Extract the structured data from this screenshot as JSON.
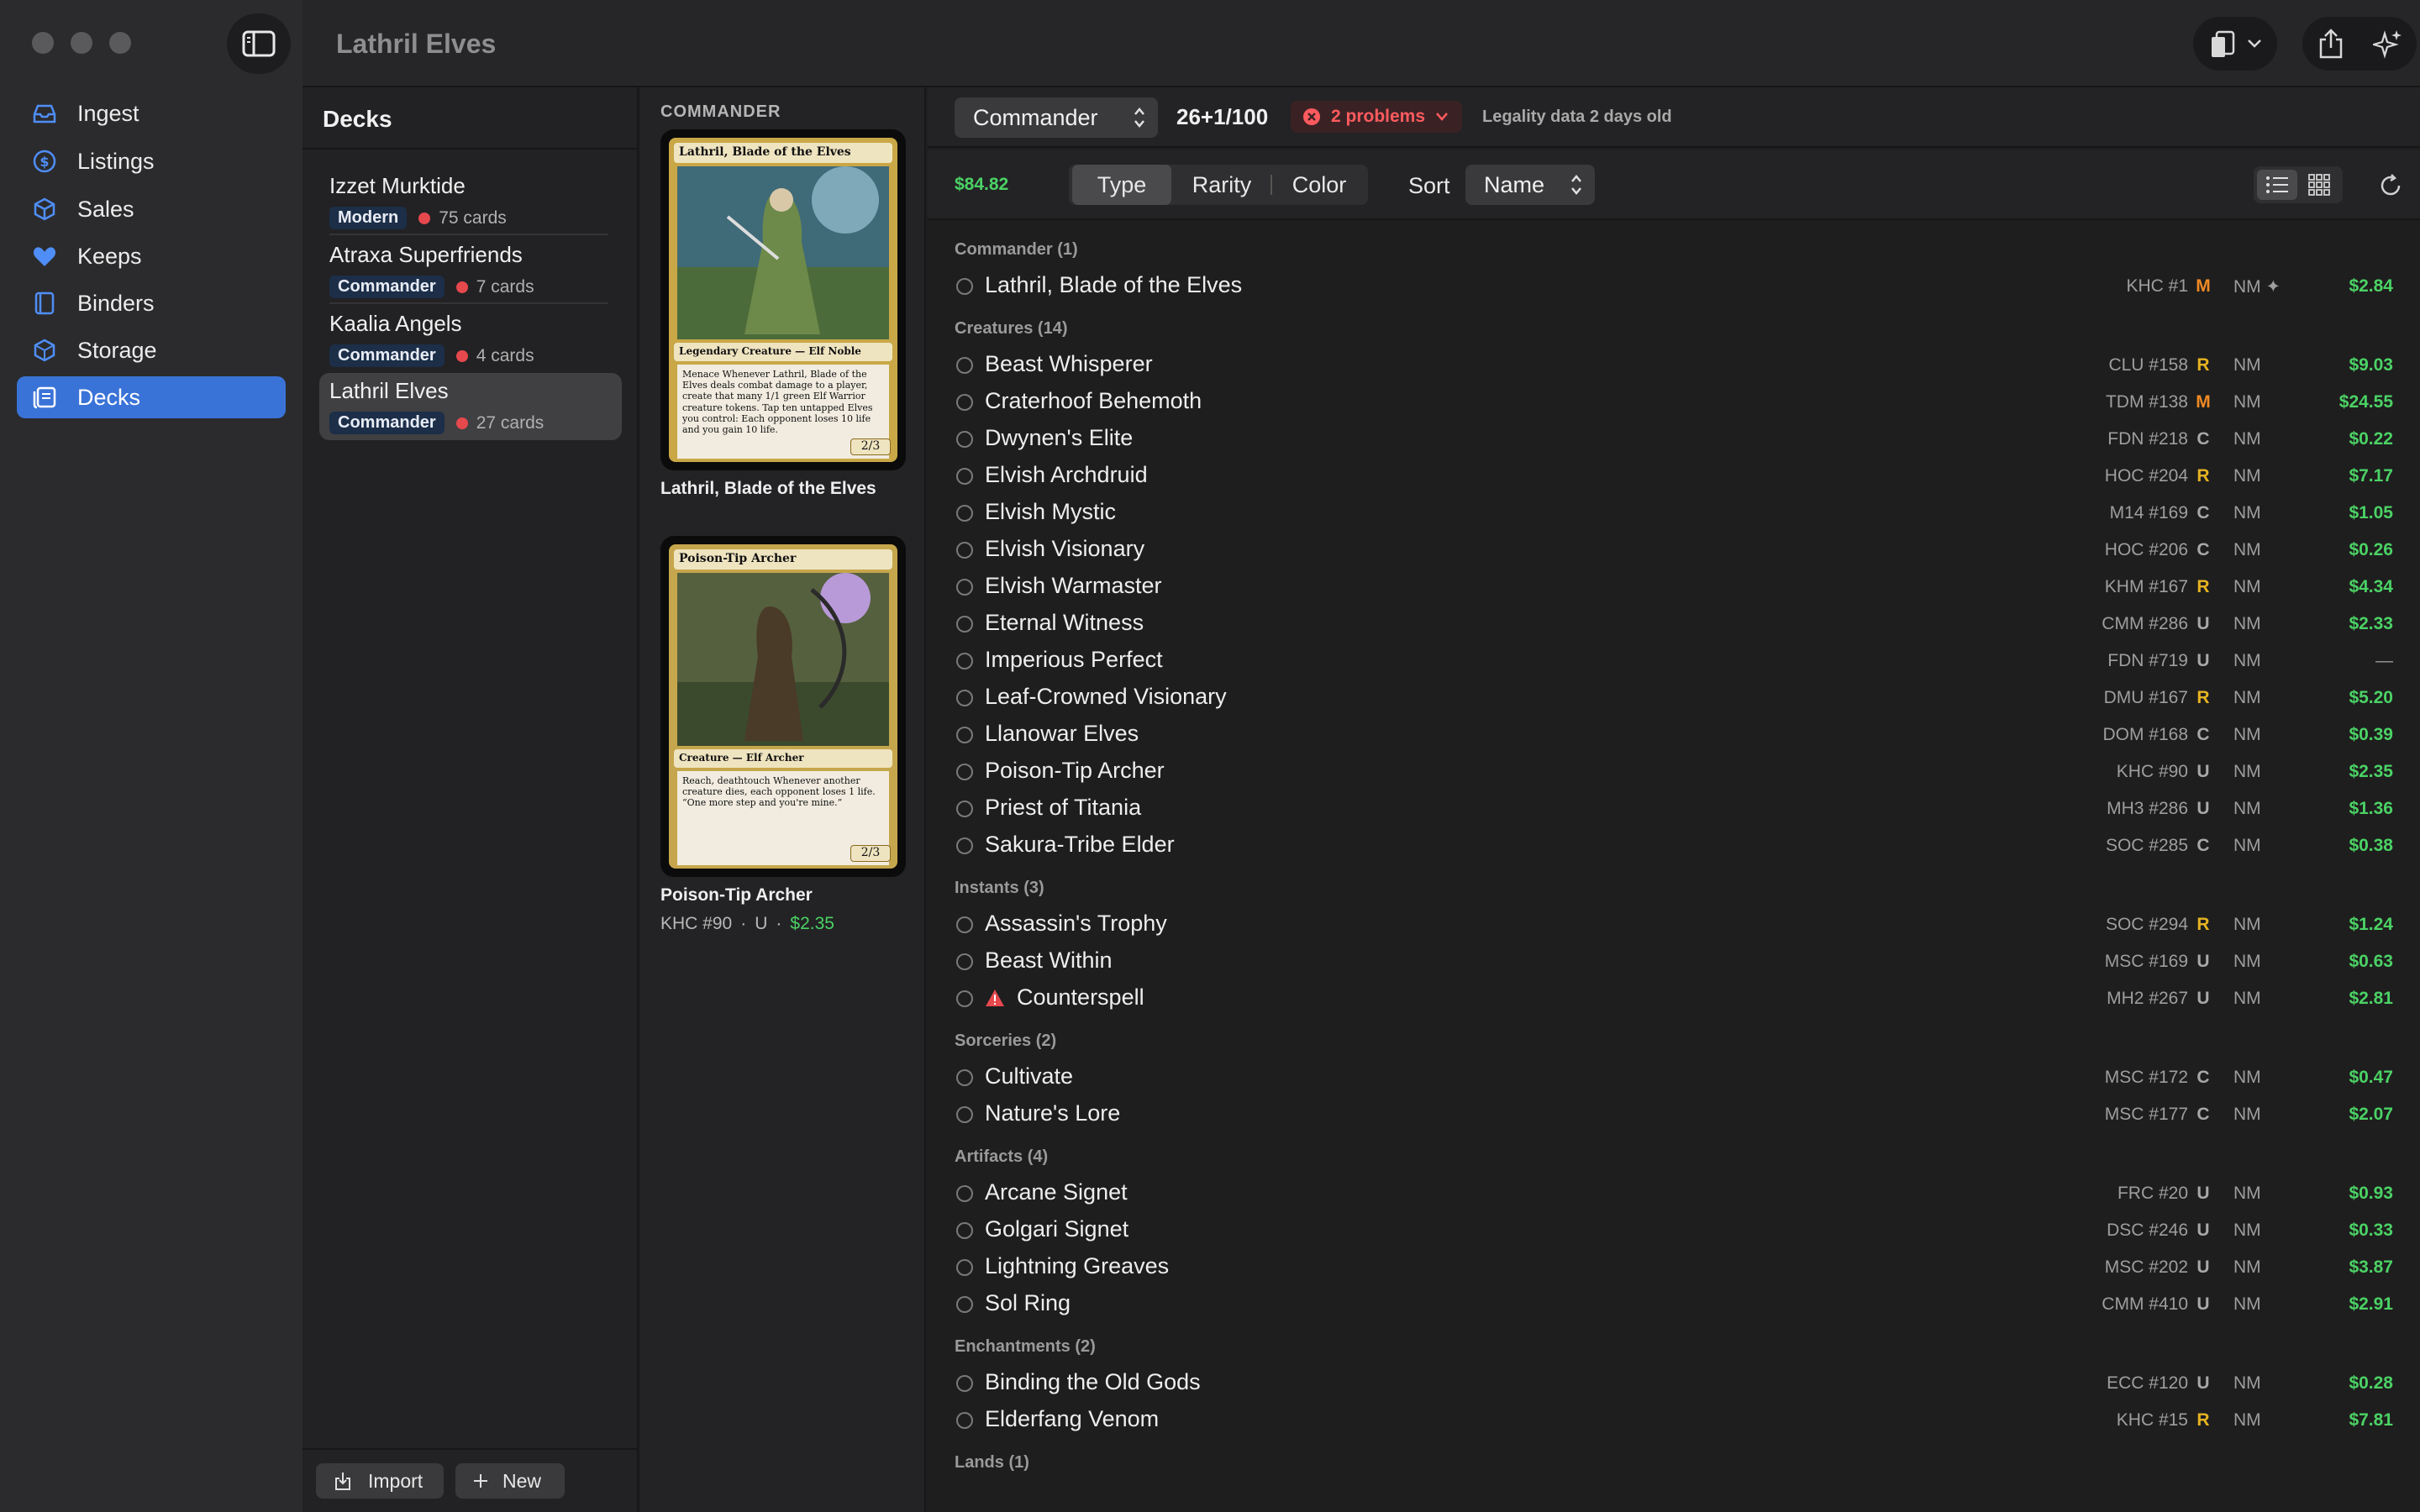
{
  "window": {
    "title": "Lathril Elves"
  },
  "sidebar": {
    "items": [
      {
        "label": "Ingest",
        "icon": "tray-icon"
      },
      {
        "label": "Listings",
        "icon": "dollar-circle-icon"
      },
      {
        "label": "Sales",
        "icon": "box-icon"
      },
      {
        "label": "Keeps",
        "icon": "heart-icon"
      },
      {
        "label": "Binders",
        "icon": "book-icon"
      },
      {
        "label": "Storage",
        "icon": "cube-icon"
      },
      {
        "label": "Decks",
        "icon": "deck-icon"
      }
    ],
    "active": "Decks"
  },
  "decks": {
    "title": "Decks",
    "items": [
      {
        "name": "Izzet Murktide",
        "format": "Modern",
        "count": "75 cards"
      },
      {
        "name": "Atraxa Superfriends",
        "format": "Commander",
        "count": "7 cards"
      },
      {
        "name": "Kaalia Angels",
        "format": "Commander",
        "count": "4 cards"
      },
      {
        "name": "Lathril Elves",
        "format": "Commander",
        "count": "27 cards"
      }
    ],
    "import_label": "Import",
    "new_label": "New"
  },
  "preview": {
    "section": "COMMANDER",
    "commander": {
      "caption": "Lathril, Blade of the Elves",
      "card_name": "Lathril, Blade of the Elves",
      "card_type": "Legendary Creature — Elf Noble",
      "card_text": "Menace\nWhenever Lathril, Blade of the Elves deals combat damage to a player, create that many 1/1 green Elf Warrior creature tokens.\nTap ten untapped Elves you control: Each opponent loses 10 life and you gain 10 life.",
      "pt": "2/3"
    },
    "selected": {
      "caption": "Poison-Tip Archer",
      "card_name": "Poison-Tip Archer",
      "card_type": "Creature — Elf Archer",
      "card_text": "Reach, deathtouch\nWhenever another creature dies, each opponent loses 1 life.\n“One more step and you're mine.”",
      "pt": "2/3",
      "set": "KHC #90",
      "rarity": "U",
      "price": "$2.35"
    }
  },
  "toolbar": {
    "format": "Commander",
    "count": "26+1/100",
    "problems": "2 problems",
    "legality": "Legality data 2 days old",
    "total": "$84.82",
    "group_tabs": [
      "Type",
      "Rarity",
      "Color"
    ],
    "active_group": "Type",
    "sort_label": "Sort",
    "sort_value": "Name"
  },
  "colors": {
    "accent": "#3a73d8",
    "price": "#4bd265",
    "mythic": "#f08a24",
    "rare": "#e6b422",
    "problem": "#ff5b5f"
  },
  "groups": [
    {
      "title": "Commander (1)",
      "cards": [
        {
          "name": "Lathril, Blade of the Elves",
          "set": "KHC #1",
          "rarity": "M",
          "cond": "NM ✦",
          "price": "$2.84"
        }
      ]
    },
    {
      "title": "Creatures (14)",
      "cards": [
        {
          "name": "Beast Whisperer",
          "set": "CLU #158",
          "rarity": "R",
          "cond": "NM",
          "price": "$9.03"
        },
        {
          "name": "Craterhoof Behemoth",
          "set": "TDM #138",
          "rarity": "M",
          "cond": "NM",
          "price": "$24.55"
        },
        {
          "name": "Dwynen's Elite",
          "set": "FDN #218",
          "rarity": "C",
          "cond": "NM",
          "price": "$0.22"
        },
        {
          "name": "Elvish Archdruid",
          "set": "HOC #204",
          "rarity": "R",
          "cond": "NM",
          "price": "$7.17"
        },
        {
          "name": "Elvish Mystic",
          "set": "M14 #169",
          "rarity": "C",
          "cond": "NM",
          "price": "$1.05"
        },
        {
          "name": "Elvish Visionary",
          "set": "HOC #206",
          "rarity": "C",
          "cond": "NM",
          "price": "$0.26"
        },
        {
          "name": "Elvish Warmaster",
          "set": "KHM #167",
          "rarity": "R",
          "cond": "NM",
          "price": "$4.34"
        },
        {
          "name": "Eternal Witness",
          "set": "CMM #286",
          "rarity": "U",
          "cond": "NM",
          "price": "$2.33"
        },
        {
          "name": "Imperious Perfect",
          "set": "FDN #719",
          "rarity": "U",
          "cond": "NM",
          "price": "—"
        },
        {
          "name": "Leaf-Crowned Visionary",
          "set": "DMU #167",
          "rarity": "R",
          "cond": "NM",
          "price": "$5.20"
        },
        {
          "name": "Llanowar Elves",
          "set": "DOM #168",
          "rarity": "C",
          "cond": "NM",
          "price": "$0.39"
        },
        {
          "name": "Poison-Tip Archer",
          "set": "KHC #90",
          "rarity": "U",
          "cond": "NM",
          "price": "$2.35"
        },
        {
          "name": "Priest of Titania",
          "set": "MH3 #286",
          "rarity": "U",
          "cond": "NM",
          "price": "$1.36"
        },
        {
          "name": "Sakura-Tribe Elder",
          "set": "SOC #285",
          "rarity": "C",
          "cond": "NM",
          "price": "$0.38"
        }
      ]
    },
    {
      "title": "Instants (3)",
      "cards": [
        {
          "name": "Assassin's Trophy",
          "set": "SOC #294",
          "rarity": "R",
          "cond": "NM",
          "price": "$1.24"
        },
        {
          "name": "Beast Within",
          "set": "MSC #169",
          "rarity": "U",
          "cond": "NM",
          "price": "$0.63"
        },
        {
          "name": "Counterspell",
          "set": "MH2 #267",
          "rarity": "U",
          "cond": "NM",
          "price": "$2.81",
          "warning": true
        }
      ]
    },
    {
      "title": "Sorceries (2)",
      "cards": [
        {
          "name": "Cultivate",
          "set": "MSC #172",
          "rarity": "C",
          "cond": "NM",
          "price": "$0.47"
        },
        {
          "name": "Nature's Lore",
          "set": "MSC #177",
          "rarity": "C",
          "cond": "NM",
          "price": "$2.07"
        }
      ]
    },
    {
      "title": "Artifacts (4)",
      "cards": [
        {
          "name": "Arcane Signet",
          "set": "FRC #20",
          "rarity": "U",
          "cond": "NM",
          "price": "$0.93"
        },
        {
          "name": "Golgari Signet",
          "set": "DSC #246",
          "rarity": "U",
          "cond": "NM",
          "price": "$0.33"
        },
        {
          "name": "Lightning Greaves",
          "set": "MSC #202",
          "rarity": "U",
          "cond": "NM",
          "price": "$3.87"
        },
        {
          "name": "Sol Ring",
          "set": "CMM #410",
          "rarity": "U",
          "cond": "NM",
          "price": "$2.91"
        }
      ]
    },
    {
      "title": "Enchantments (2)",
      "cards": [
        {
          "name": "Binding the Old Gods",
          "set": "ECC #120",
          "rarity": "U",
          "cond": "NM",
          "price": "$0.28"
        },
        {
          "name": "Elderfang Venom",
          "set": "KHC #15",
          "rarity": "R",
          "cond": "NM",
          "price": "$7.81"
        }
      ]
    },
    {
      "title": "Lands (1)",
      "cards": []
    }
  ]
}
